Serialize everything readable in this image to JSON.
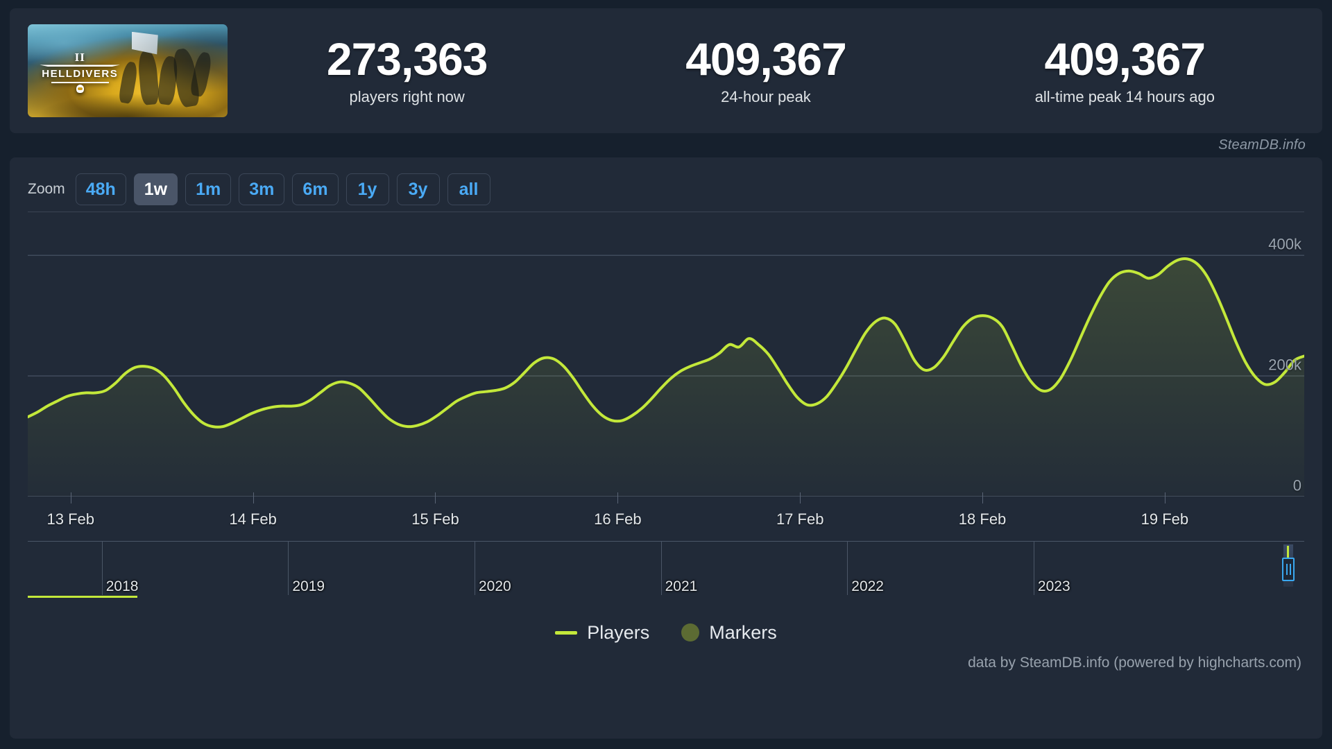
{
  "header": {
    "game_banner_title": "HELLDIVERS",
    "game_banner_numeral": "II",
    "stats": [
      {
        "value": "273,363",
        "label": "players right now"
      },
      {
        "value": "409,367",
        "label": "24-hour peak"
      },
      {
        "value": "409,367",
        "label": "all-time peak 14 hours ago"
      }
    ]
  },
  "watermark": "SteamDB.info",
  "zoom": {
    "label": "Zoom",
    "buttons": [
      {
        "label": "48h",
        "active": false
      },
      {
        "label": "1w",
        "active": true
      },
      {
        "label": "1m",
        "active": false
      },
      {
        "label": "3m",
        "active": false
      },
      {
        "label": "6m",
        "active": false
      },
      {
        "label": "1y",
        "active": false
      },
      {
        "label": "3y",
        "active": false
      },
      {
        "label": "all",
        "active": false
      }
    ]
  },
  "legend": [
    {
      "name": "Players",
      "type": "line",
      "color": "#c3e83a"
    },
    {
      "name": "Markers",
      "type": "dot",
      "color": "#5c6b33"
    }
  ],
  "credits": "data by SteamDB.info (powered by highcharts.com)",
  "navigator": {
    "years": [
      "2018",
      "2019",
      "2020",
      "2021",
      "2022",
      "2023"
    ],
    "selected_range_label": "1w"
  },
  "chart_data": {
    "type": "area",
    "title": "",
    "xlabel": "",
    "ylabel": "",
    "series_name": "Players",
    "line_color": "#c3e83a",
    "grid": true,
    "legend_position": "bottom",
    "ylim": [
      0,
      460000
    ],
    "yticks": [
      0,
      200000,
      400000
    ],
    "ytick_labels": [
      "0",
      "200k",
      "400k"
    ],
    "xticks": [
      "13 Feb",
      "14 Feb",
      "15 Feb",
      "16 Feb",
      "17 Feb",
      "18 Feb",
      "19 Feb"
    ],
    "xlim": [
      "12 Feb 12:00",
      "19 Feb 22:00"
    ],
    "x": [
      0.0,
      0.04,
      0.08,
      0.13,
      0.17,
      0.21,
      0.25,
      0.29,
      0.33,
      0.37,
      0.41,
      0.45,
      0.49,
      0.53,
      0.57,
      0.61,
      0.65,
      0.69,
      0.73,
      0.77,
      0.81,
      0.85,
      0.89,
      0.93,
      0.97,
      1.01,
      1.05,
      1.09,
      1.13,
      1.17,
      1.21,
      1.25,
      1.29,
      1.33,
      1.37,
      1.41,
      1.45,
      1.49,
      1.53,
      1.57,
      1.61,
      1.65,
      1.69,
      1.73,
      1.77,
      1.81,
      1.85,
      1.89,
      1.93,
      1.97,
      2.01,
      2.05,
      2.09,
      2.13,
      2.17,
      2.21,
      2.25,
      2.29,
      2.33,
      2.37,
      2.41,
      2.45,
      2.49,
      2.53,
      2.57,
      2.61,
      2.65,
      2.69,
      2.73,
      2.77,
      2.81,
      2.85,
      2.89,
      2.93,
      2.97,
      3.01,
      3.05,
      3.09,
      3.13,
      3.17,
      3.21,
      3.25,
      3.29,
      3.33,
      3.37,
      3.41,
      3.45,
      3.49,
      3.53,
      3.57,
      3.61,
      3.65,
      3.69,
      3.73,
      3.77,
      3.81,
      3.85,
      3.89,
      3.93,
      3.97
    ],
    "values": [
      132000,
      140000,
      150000,
      158000,
      166000,
      170000,
      172000,
      172000,
      176000,
      188000,
      204000,
      214000,
      216000,
      212000,
      200000,
      180000,
      156000,
      136000,
      122000,
      116000,
      116000,
      122000,
      130000,
      138000,
      144000,
      148000,
      150000,
      150000,
      152000,
      160000,
      172000,
      184000,
      190000,
      188000,
      180000,
      164000,
      146000,
      130000,
      120000,
      116000,
      118000,
      124000,
      134000,
      146000,
      158000,
      166000,
      172000,
      174000,
      176000,
      180000,
      190000,
      206000,
      222000,
      230000,
      228000,
      216000,
      196000,
      172000,
      150000,
      134000,
      126000,
      126000,
      134000,
      146000,
      162000,
      180000,
      196000,
      208000,
      216000,
      222000,
      228000,
      238000,
      252000,
      248000,
      262000,
      252000,
      236000,
      212000,
      186000,
      164000,
      152000,
      154000,
      166000,
      188000,
      214000,
      244000,
      272000,
      290000,
      296000,
      286000,
      258000,
      226000,
      210000,
      214000,
      232000,
      258000,
      282000,
      296000,
      300000,
      296000
    ],
    "values_tail": [
      282000,
      250000,
      216000,
      190000,
      176000,
      178000,
      196000,
      226000,
      262000,
      298000,
      330000,
      356000,
      370000,
      374000,
      370000,
      362000,
      368000,
      382000,
      392000,
      394000,
      386000,
      366000,
      334000,
      296000,
      256000,
      222000,
      198000,
      186000,
      190000,
      206000,
      226000,
      233000
    ],
    "current_value": 273363,
    "peak_value": 409367,
    "annotations": []
  }
}
